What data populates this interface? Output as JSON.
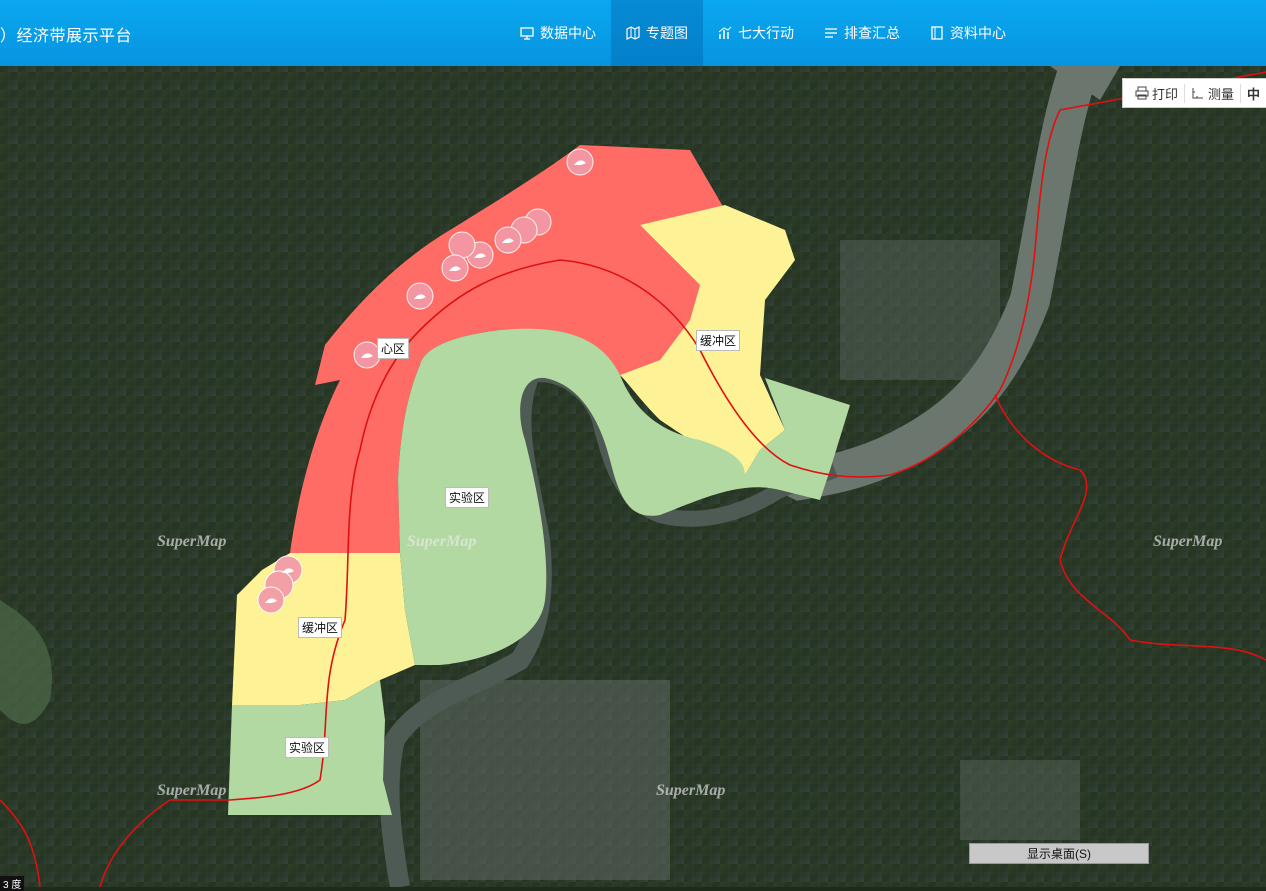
{
  "header": {
    "title": "）经济带展示平台",
    "nav": [
      {
        "label": "数据中心",
        "icon": "monitor-icon"
      },
      {
        "label": "专题图",
        "icon": "map-icon",
        "active": true
      },
      {
        "label": "七大行动",
        "icon": "chart-icon"
      },
      {
        "label": "排查汇总",
        "icon": "list-icon"
      },
      {
        "label": "资料中心",
        "icon": "book-icon"
      }
    ]
  },
  "toolbar": {
    "print": "打印",
    "measure": "测量",
    "cut": "中"
  },
  "zones": {
    "core": "心区",
    "buffer1": "缓冲区",
    "buffer2": "缓冲区",
    "exp1": "实验区",
    "exp2": "实验区"
  },
  "colors": {
    "core": "#ff6c66",
    "buffer": "#fdf396",
    "experimental": "#b3d9a2",
    "river": "#5e6a63",
    "boundary": "#e01010",
    "marker": "#f29aa8"
  },
  "watermark": "SuperMap",
  "desktop_button": "显示桌面(S)",
  "scale_text": "3 度",
  "chart_data": {
    "type": "map",
    "zones": [
      {
        "name": "心区",
        "category": "core"
      },
      {
        "name": "缓冲区",
        "category": "buffer"
      },
      {
        "name": "缓冲区",
        "category": "buffer"
      },
      {
        "name": "实验区",
        "category": "experimental"
      },
      {
        "name": "实验区",
        "category": "experimental"
      }
    ]
  }
}
